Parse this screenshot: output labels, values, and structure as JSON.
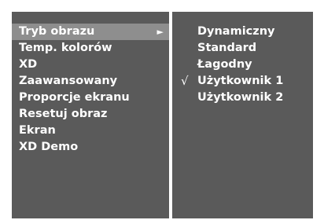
{
  "colors": {
    "background": "#ffffff",
    "panel": "#5a5a5a",
    "highlight": "#8e8e8e",
    "text": "#ffffff"
  },
  "icons": {
    "submenu_arrow": "triangle-right-icon",
    "check": "checkmark-icon"
  },
  "main_menu": {
    "items": [
      {
        "label": "Tryb obrazu",
        "selected": true,
        "arrow": "►"
      },
      {
        "label": "Temp. kolorów"
      },
      {
        "label": "XD"
      },
      {
        "label": "Zaawansowany"
      },
      {
        "label": "Proporcje ekranu"
      },
      {
        "label": "Resetuj obraz"
      },
      {
        "label": "Ekran"
      },
      {
        "label": "XD Demo"
      }
    ]
  },
  "sub_menu": {
    "items": [
      {
        "label": "Dynamiczny"
      },
      {
        "label": "Standard"
      },
      {
        "label": "Łagodny"
      },
      {
        "label": "Użytkownik 1",
        "checked": true,
        "check": "√"
      },
      {
        "label": "Użytkownik 2"
      }
    ]
  }
}
